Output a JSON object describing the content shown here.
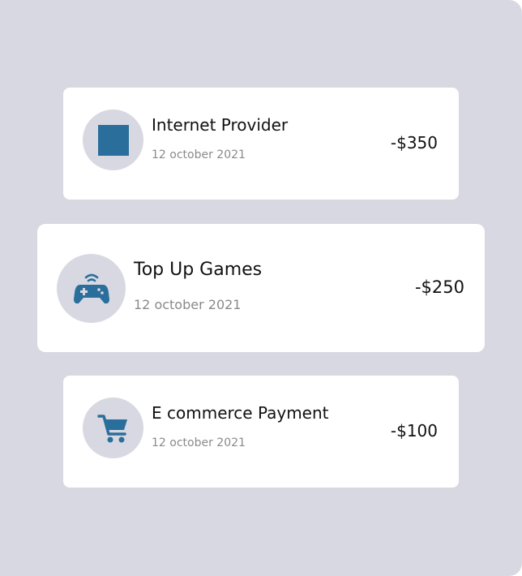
{
  "colors": {
    "background": "#d8d8e2",
    "card": "#ffffff",
    "icon_accent": "#2a6f9b",
    "date_text": "#8a8a8a"
  },
  "transactions": [
    {
      "icon": "internet-provider-icon",
      "title": "Internet Provider",
      "date": "12 october 2021",
      "amount": "-$350"
    },
    {
      "icon": "game-controller-icon",
      "title": "Top Up Games",
      "date": "12 october 2021",
      "amount": "-$250"
    },
    {
      "icon": "shopping-cart-icon",
      "title": "E commerce Payment",
      "date": "12 october 2021",
      "amount": "-$100"
    }
  ]
}
